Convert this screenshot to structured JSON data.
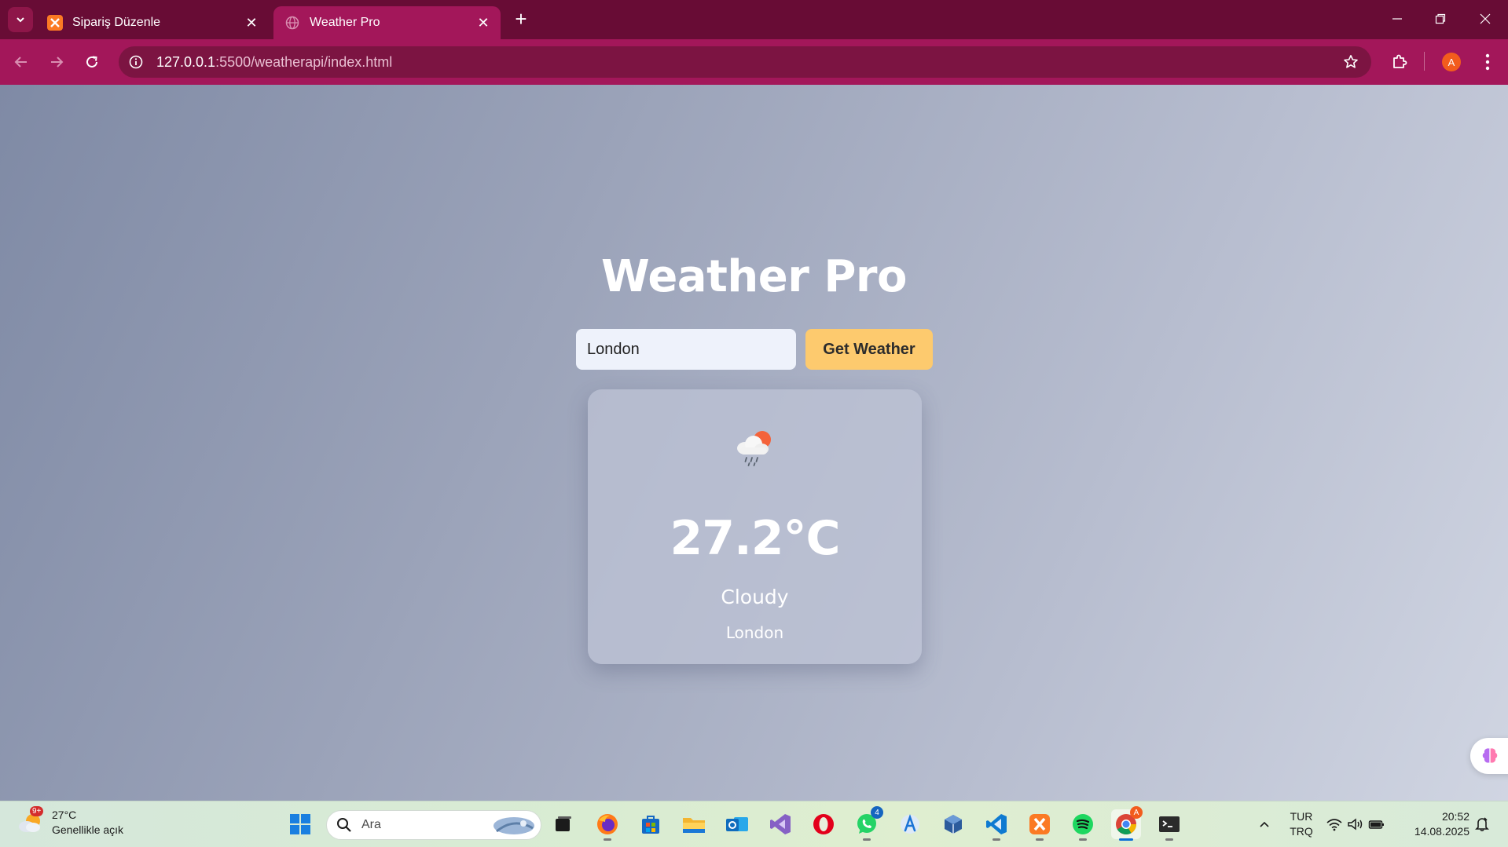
{
  "browser": {
    "tabs": [
      {
        "title": "Sipariş Düzenle",
        "active": false
      },
      {
        "title": "Weather Pro",
        "active": true
      }
    ],
    "address": {
      "host": "127.0.0.1",
      "path": ":5500/weatherapi/index.html"
    },
    "profile_initial": "A"
  },
  "app": {
    "title": "Weather Pro",
    "search": {
      "value": "London",
      "placeholder": ""
    },
    "button_label": "Get Weather",
    "result": {
      "icon": "cloud-sun-rain-icon",
      "temperature": "27.2°C",
      "description": "Cloudy",
      "city": "London"
    }
  },
  "taskbar": {
    "weather": {
      "temp": "27°C",
      "condition": "Genellikle açık",
      "badge": "9+"
    },
    "search_placeholder": "Ara",
    "whatsapp_badge": "4",
    "language": {
      "line1": "TUR",
      "line2": "TRQ"
    },
    "clock": {
      "time": "20:52",
      "date": "14.08.2025"
    }
  },
  "colors": {
    "tab_bar": "#680c35",
    "toolbar": "#a3175a",
    "accent_button": "#fdca6e"
  }
}
